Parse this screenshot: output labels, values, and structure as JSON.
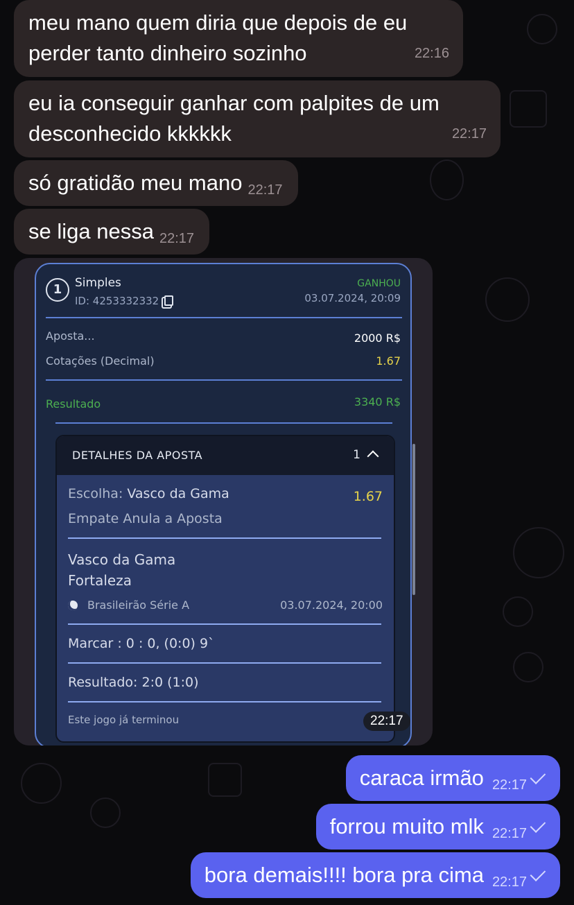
{
  "messages_in": [
    {
      "text_line1": "meu mano quem diria que depois de eu",
      "text_line2": "perder tanto dinheiro sozinho",
      "time": "22:16"
    },
    {
      "text_line1": "eu ia conseguir ganhar com palpites de um",
      "text_line2": "desconhecido kkkkkk",
      "time": "22:17"
    },
    {
      "text": "só gratidão meu mano",
      "time": "22:17"
    },
    {
      "text": "se liga nessa",
      "time": "22:17"
    }
  ],
  "bet_card": {
    "number": "1",
    "type": "Simples",
    "id_label": "ID: 4253332332",
    "status": "GANHOU",
    "datetime": "03.07.2024, 20:09",
    "stake_label": "Aposta...",
    "stake_value": "2000 R$",
    "odds_label": "Cotações (Decimal)",
    "odds_value": "1.67",
    "result_label": "Resultado",
    "result_value": "3340 R$",
    "details": {
      "title": "DETALHES DA APOSTA",
      "count": "1",
      "choice_label": "Escolha:",
      "choice_value": "Vasco da Gama",
      "choice_odds": "1.67",
      "market": "Empate Anula a Aposta",
      "team1": "Vasco da Gama",
      "team2": "Fortaleza",
      "league": "Brasileirão Série A",
      "match_datetime": "03.07.2024, 20:00",
      "score_line": "Marcar : 0 : 0, (0:0) 9`",
      "result_line": "Resultado: 2:0 (1:0)",
      "footer": "Este jogo já terminou"
    },
    "time": "22:17"
  },
  "messages_out": [
    {
      "text": "caraca irmão",
      "time": "22:17"
    },
    {
      "text": "forrou muito mlk",
      "time": "22:17"
    },
    {
      "text": "bora demais!!!! bora pra cima",
      "time": "22:17"
    }
  ]
}
